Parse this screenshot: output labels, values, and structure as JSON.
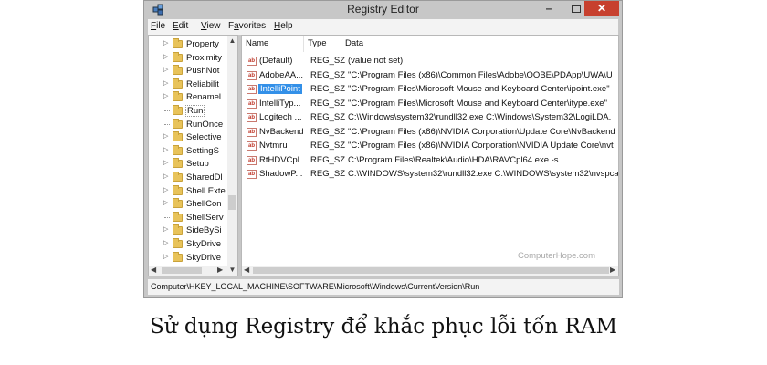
{
  "window": {
    "title": "Registry Editor",
    "minimize_glyph": "–",
    "close_glyph": "✕"
  },
  "menu": [
    "File",
    "Edit",
    "View",
    "Favorites",
    "Help"
  ],
  "menu_mnemonics": [
    "F",
    "E",
    "V",
    "a",
    "H"
  ],
  "tree": {
    "items": [
      "Property",
      "Proximity",
      "PushNot",
      "Reliabilit",
      "Renamel",
      "Run",
      "RunOnce",
      "Selective",
      "SettingS",
      "Setup",
      "SharedDl",
      "Shell Exte",
      "ShellCon",
      "ShellServ",
      "SideBySi",
      "SkyDrive",
      "SkyDrive"
    ],
    "selected_index": 5
  },
  "list": {
    "columns": [
      "Name",
      "Type",
      "Data"
    ],
    "rows": [
      {
        "name": "(Default)",
        "type": "REG_SZ",
        "data": "(value not set)"
      },
      {
        "name": "AdobeAA...",
        "type": "REG_SZ",
        "data": "\"C:\\Program Files (x86)\\Common Files\\Adobe\\OOBE\\PDApp\\UWA\\U"
      },
      {
        "name": "IntelliPoint",
        "type": "REG_SZ",
        "data": "\"C:\\Program Files\\Microsoft Mouse and Keyboard Center\\ipoint.exe\""
      },
      {
        "name": "IntelliTyp...",
        "type": "REG_SZ",
        "data": "\"C:\\Program Files\\Microsoft Mouse and Keyboard Center\\itype.exe\""
      },
      {
        "name": "Logitech ...",
        "type": "REG_SZ",
        "data": "C:\\Windows\\system32\\rundll32.exe C:\\Windows\\System32\\LogiLDA."
      },
      {
        "name": "NvBackend",
        "type": "REG_SZ",
        "data": "\"C:\\Program Files (x86)\\NVIDIA Corporation\\Update Core\\NvBackend"
      },
      {
        "name": "Nvtmru",
        "type": "REG_SZ",
        "data": "\"C:\\Program Files (x86)\\NVIDIA Corporation\\NVIDIA Update Core\\nvt"
      },
      {
        "name": "RtHDVCpl",
        "type": "REG_SZ",
        "data": "C:\\Program Files\\Realtek\\Audio\\HDA\\RAVCpl64.exe -s"
      },
      {
        "name": "ShadowP...",
        "type": "REG_SZ",
        "data": "C:\\WINDOWS\\system32\\rundll32.exe C:\\WINDOWS\\system32\\nvspca"
      }
    ],
    "selected_index": 2,
    "value_icon_text": "ab"
  },
  "watermark": "ComputerHope.com",
  "status_path": "Computer\\HKEY_LOCAL_MACHINE\\SOFTWARE\\Microsoft\\Windows\\CurrentVersion\\Run",
  "caption": "Sử dụng Registry để khắc phục lỗi tốn RAM",
  "colors": {
    "close_button": "#c7402e",
    "selection": "#3390e8",
    "folder": "#e8c35a"
  }
}
